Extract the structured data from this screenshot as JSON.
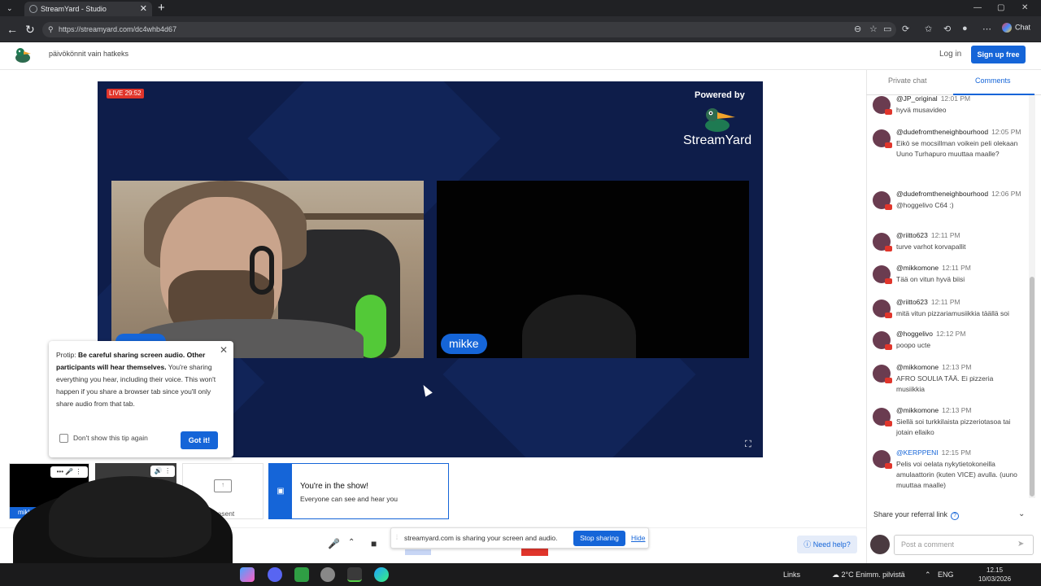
{
  "browser": {
    "tab_title": "StreamYard - Studio",
    "tab_close": "✕",
    "new_tab": "+",
    "url": "https://streamyard.com/dc4whb4d67",
    "chat_label": "Chat",
    "window_controls": [
      "—",
      "▢",
      "✕"
    ]
  },
  "header": {
    "studio_title": "päivökönnit vain hatkeks",
    "login": "Log in",
    "signup": "Sign up free"
  },
  "stage": {
    "live_badge": "LIVE 29:52",
    "powered_by": "Powered by",
    "brand": "StreamYard",
    "participant_right": "mikke",
    "fullscreen_icon": "⛶"
  },
  "protip": {
    "lead": "Protip: ",
    "bold": "Be careful sharing screen audio. Other participants will hear themselves.",
    "body": " You're sharing everything you hear, including their voice. This won't happen if you share a browser tab since you'll only share audio from that tab.",
    "checkbox_label": "Don't show this tip again",
    "button": "Got it!",
    "close": "✕"
  },
  "thumbnails": {
    "self_name": "mikke",
    "self_controls": "••• 🎤 ⋮",
    "screen_controls": "🔊 ⋮",
    "present_label": "Present",
    "inshow_title": "You're in the show!",
    "inshow_sub": "Everyone can see and hear you"
  },
  "share_bar": {
    "grip": "⦙",
    "text": "streamyard.com is sharing your screen and audio.",
    "stop": "Stop sharing",
    "hide": "Hide"
  },
  "controls": {
    "mic": "🎤",
    "chevron": "⌃",
    "cam": "■",
    "need_help": "Need help?"
  },
  "panel": {
    "tab_private": "Private chat",
    "tab_comments": "Comments",
    "comments": [
      {
        "user": "@JP_original",
        "time": "12:01 PM",
        "text": "hyvä musavideo"
      },
      {
        "user": "@dudefromtheneighbourhood",
        "time": "12:05 PM",
        "text": "Eikö se mocsillman voikein peli olekaan Uuno Turhapuro muuttaa maalle?"
      },
      {
        "user": "@dudefromtheneighbourhood",
        "time": "12:06 PM",
        "text": "@hoggelivo C64 :)"
      },
      {
        "user": "@riitto623",
        "time": "12:11 PM",
        "text": "turve varhot korvapallit"
      },
      {
        "user": "@mikkomone",
        "time": "12:11 PM",
        "text": "Tää on vitun hyvä biisi"
      },
      {
        "user": "@riitto623",
        "time": "12:11 PM",
        "text": "mitä vitun pizzariamusiikkia täällä soi"
      },
      {
        "user": "@hoggelivo",
        "time": "12:12 PM",
        "text": "poopo ucte"
      },
      {
        "user": "@mikkomone",
        "time": "12:13 PM",
        "text": "AFRO SOULIA TÄÄ. Ei pizzeria musiikkia"
      },
      {
        "user": "@mikkomone",
        "time": "12:13 PM",
        "text": "Siellä soi turkkilaista pizzeriotasoa tai jotain ellaiko"
      },
      {
        "user": "@KERPPENI",
        "time": "12:15 PM",
        "text": "Pelis voi oelata nykytietokoneilla amulaattorin (kuten VICE) avulla. (uuno muuttaa maalle)"
      }
    ],
    "referral": "Share your referral link",
    "referral_q": "?",
    "referral_chev": "⌄",
    "post_placeholder": "Post a comment",
    "send_icon": "➤"
  },
  "taskbar": {
    "links": "Links",
    "weather": "2°C  Enimm. pilvistä",
    "lang": "ENG",
    "time": "12.15",
    "date": "10/03/2026"
  },
  "colors": {
    "accent": "#1565d8",
    "live": "#e0352b",
    "stage_bg": "#0e1d4a"
  }
}
